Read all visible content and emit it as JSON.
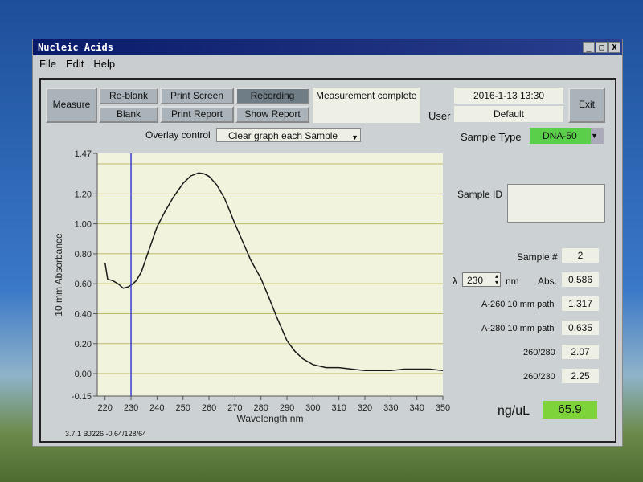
{
  "window": {
    "title": "Nucleic Acids",
    "controls": [
      "_",
      "□",
      "X"
    ]
  },
  "menu": [
    "File",
    "Edit",
    "Help"
  ],
  "toolbar": {
    "measure": "Measure",
    "reblank": "Re-blank",
    "blank": "Blank",
    "print_screen": "Print Screen",
    "print_report": "Print Report",
    "recording": "Recording",
    "show_report": "Show Report",
    "status": "Measurement complete",
    "datetime": "2016-1-13 13:30",
    "user_label": "User",
    "user": "Default",
    "exit": "Exit"
  },
  "overlay": {
    "label": "Overlay control",
    "value": "Clear graph each Sample"
  },
  "sample": {
    "type_label": "Sample Type",
    "type": "DNA-50",
    "id_label": "Sample ID",
    "id": "",
    "num_label": "Sample #",
    "num": "2",
    "lambda_symbol": "λ",
    "lambda": "230",
    "nm": "nm",
    "abs_label": "Abs.",
    "abs": "0.586",
    "a260_label": "A-260 10 mm path",
    "a260": "1.317",
    "a280_label": "A-280 10 mm path",
    "a280": "0.635",
    "r260_280_label": "260/280",
    "r260_280": "2.07",
    "r260_230_label": "260/230",
    "r260_230": "2.25",
    "conc_label": "ng/uL",
    "conc": "65.9"
  },
  "footer": "3.7.1 BJ226 -0.64/128/64",
  "colors": {
    "plot_bg": "#f2f3dc",
    "grid": "#b8b86a",
    "curve": "#1a1a1a",
    "cursor": "#3a3ad0",
    "concentration": "#7ed23a",
    "sample_type": "#5ad04a"
  },
  "chart_data": {
    "type": "line",
    "xlabel": "Wavelength nm",
    "ylabel": "10 mm Absorbance",
    "xlim": [
      217,
      350
    ],
    "ylim": [
      -0.15,
      1.47
    ],
    "xticks": [
      220,
      230,
      240,
      250,
      260,
      270,
      280,
      290,
      300,
      310,
      320,
      330,
      340,
      350
    ],
    "yticks": [
      "1.47",
      "1.20",
      "1.00",
      "0.80",
      "0.60",
      "0.40",
      "0.20",
      "0.00",
      "-0.15"
    ],
    "grid_y": [
      1.4,
      1.2,
      1.0,
      0.8,
      0.6,
      0.4,
      0.2,
      0.0
    ],
    "cursor_x": 230,
    "x": [
      220,
      221,
      223,
      225,
      227,
      229,
      230,
      232,
      234,
      236,
      238,
      240,
      243,
      246,
      250,
      253,
      256,
      258,
      260,
      263,
      266,
      270,
      273,
      276,
      280,
      283,
      286,
      290,
      293,
      296,
      300,
      305,
      310,
      315,
      320,
      325,
      330,
      335,
      340,
      345,
      350
    ],
    "y": [
      0.74,
      0.63,
      0.62,
      0.6,
      0.57,
      0.58,
      0.59,
      0.62,
      0.68,
      0.78,
      0.88,
      0.98,
      1.08,
      1.17,
      1.27,
      1.32,
      1.34,
      1.335,
      1.317,
      1.26,
      1.17,
      1.0,
      0.88,
      0.76,
      0.635,
      0.51,
      0.38,
      0.22,
      0.15,
      0.1,
      0.06,
      0.04,
      0.04,
      0.03,
      0.02,
      0.02,
      0.02,
      0.03,
      0.03,
      0.03,
      0.02
    ]
  }
}
